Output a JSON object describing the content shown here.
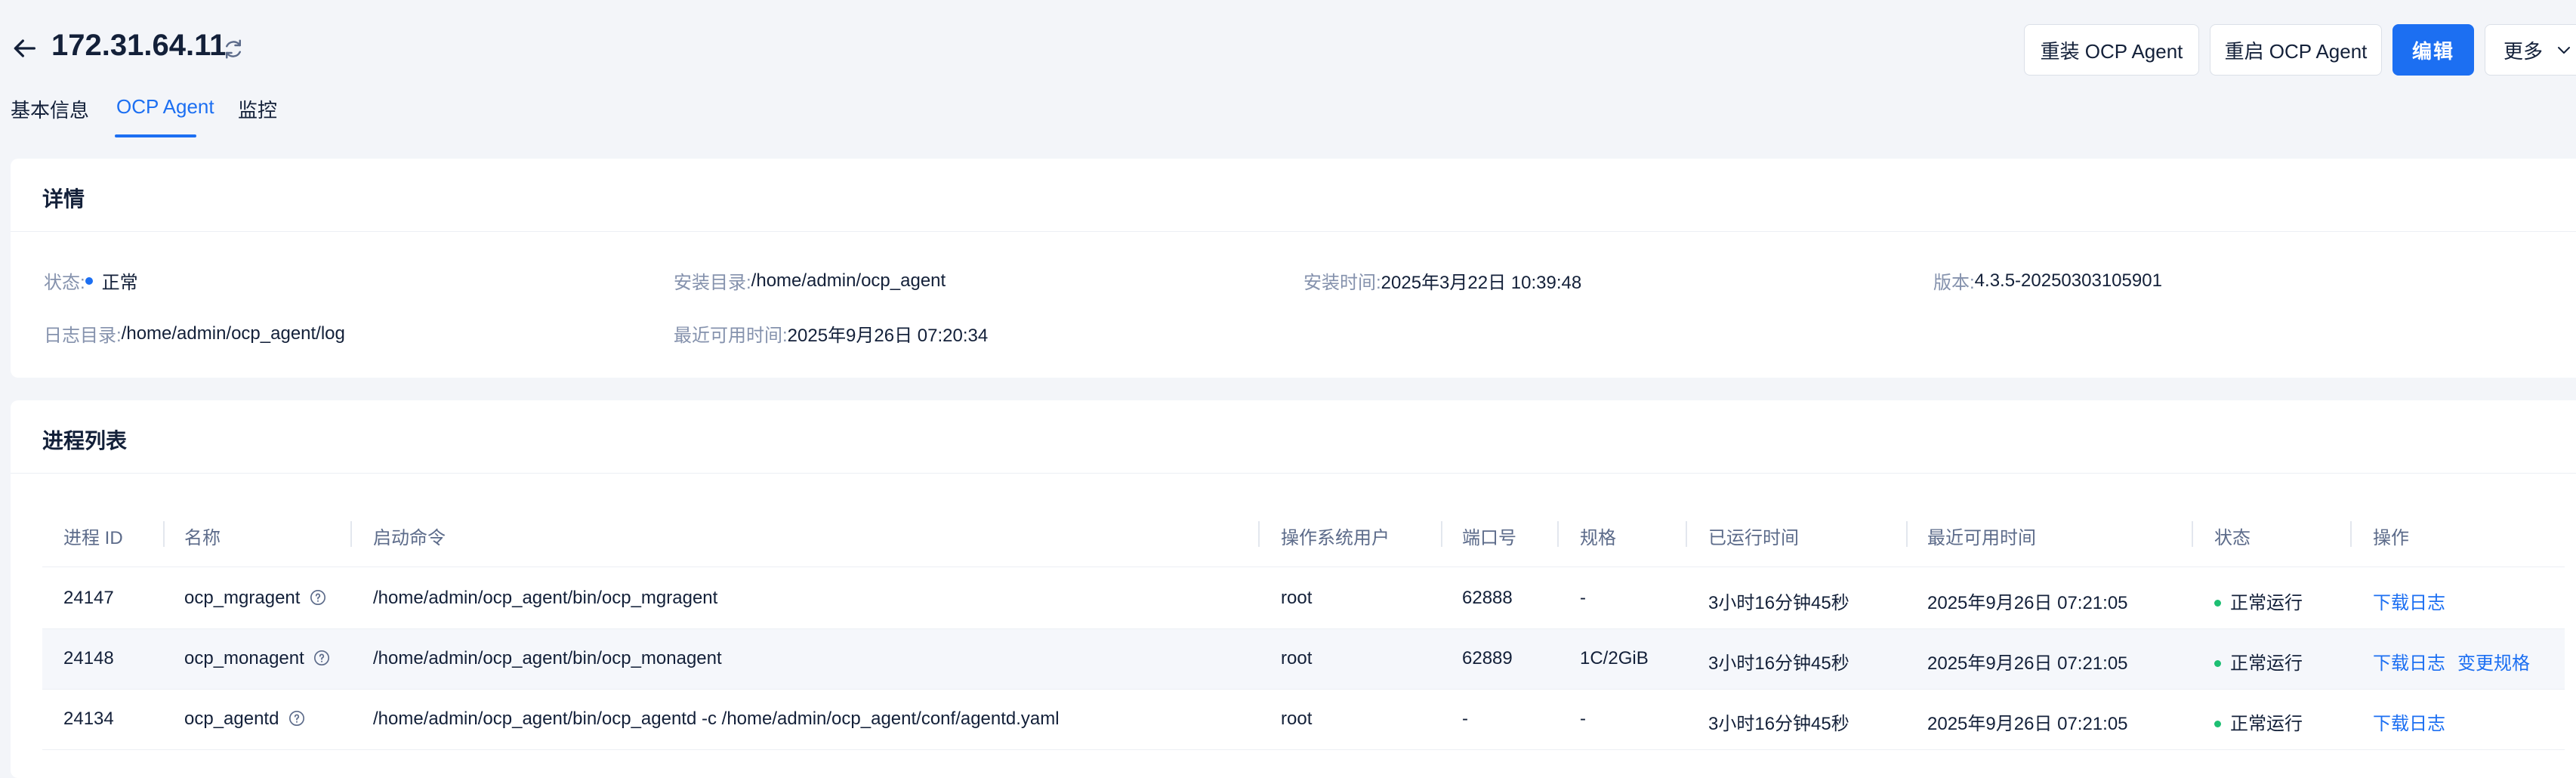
{
  "header": {
    "title": "172.31.64.11",
    "buttons": {
      "reinstall": "重装 OCP Agent",
      "restart": "重启 OCP Agent",
      "edit": "编辑",
      "more": "更多"
    }
  },
  "tabs": [
    {
      "label": "基本信息",
      "active": false
    },
    {
      "label": "OCP Agent",
      "active": true
    },
    {
      "label": "监控",
      "active": false
    }
  ],
  "details": {
    "title": "详情",
    "status_label": "状态:",
    "status_value": "正常",
    "install_dir_label": "安装目录:",
    "install_dir_value": "/home/admin/ocp_agent",
    "install_time_label": "安装时间:",
    "install_time_value": "2025年3月22日 10:39:48",
    "version_label": "版本:",
    "version_value": "4.3.5-20250303105901",
    "log_dir_label": "日志目录:",
    "log_dir_value": "/home/admin/ocp_agent/log",
    "last_available_label": "最近可用时间:",
    "last_available_value": "2025年9月26日 07:20:34"
  },
  "process_list": {
    "title": "进程列表",
    "columns": [
      "进程 ID",
      "名称",
      "启动命令",
      "操作系统用户",
      "端口号",
      "规格",
      "已运行时间",
      "最近可用时间",
      "状态",
      "操作"
    ],
    "rows": [
      {
        "pid": "24147",
        "name": "ocp_mgragent",
        "command": "/home/admin/ocp_agent/bin/ocp_mgragent",
        "user": "root",
        "port": "62888",
        "spec": "-",
        "uptime": "3小时16分钟45秒",
        "last_available": "2025年9月26日 07:21:05",
        "status": "正常运行",
        "action1": "下载日志",
        "action2": ""
      },
      {
        "pid": "24148",
        "name": "ocp_monagent",
        "command": "/home/admin/ocp_agent/bin/ocp_monagent",
        "user": "root",
        "port": "62889",
        "spec": "1C/2GiB",
        "uptime": "3小时16分钟45秒",
        "last_available": "2025年9月26日 07:21:05",
        "status": "正常运行",
        "action1": "下载日志",
        "action2": "变更规格"
      },
      {
        "pid": "24134",
        "name": "ocp_agentd",
        "command": "/home/admin/ocp_agent/bin/ocp_agentd -c /home/admin/ocp_agent/conf/agentd.yaml",
        "user": "root",
        "port": "-",
        "spec": "-",
        "uptime": "3小时16分钟45秒",
        "last_available": "2025年9月26日 07:21:05",
        "status": "正常运行",
        "action1": "下载日志",
        "action2": ""
      }
    ]
  },
  "colors": {
    "accent": "#1c6ff2",
    "status_normal_dot": "#1c6ff2",
    "status_running_dot": "#1dbf73",
    "label": "#8592ad",
    "text": "#132039"
  }
}
